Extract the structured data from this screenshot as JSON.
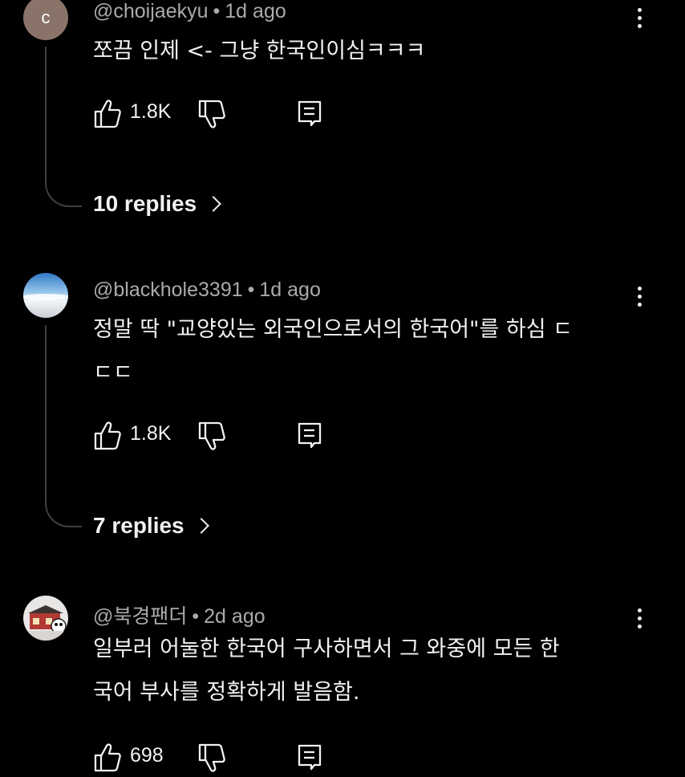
{
  "comments": [
    {
      "avatar_letter": "c",
      "author": "@choijaekyu",
      "separator": "•",
      "time": "1d ago",
      "lines": [
        "쪼끔 인제 <- 그냥 한국인이심ㅋㅋㅋ"
      ],
      "likes": "1.8K",
      "replies": "10 replies"
    },
    {
      "author": "@blackhole3391",
      "separator": "•",
      "time": "1d ago",
      "lines": [
        "정말 딱 \"교양있는 외국인으로서의 한국어\"를 하심 ㄷ",
        "ㄷㄷ"
      ],
      "likes": "1.8K",
      "replies": "7 replies"
    },
    {
      "author": "@북경팬더",
      "separator": "•",
      "time": "2d ago",
      "lines": [
        "일부러 어눌한 한국어 구사하면서 그 와중에 모든 한",
        "국어 부사를 정확하게 발음함."
      ],
      "likes": "698"
    }
  ],
  "colors": {
    "background": "#000000",
    "text": "#f1f1f1",
    "meta": "#aaaaaa",
    "avatar_c": "#8a7368"
  }
}
